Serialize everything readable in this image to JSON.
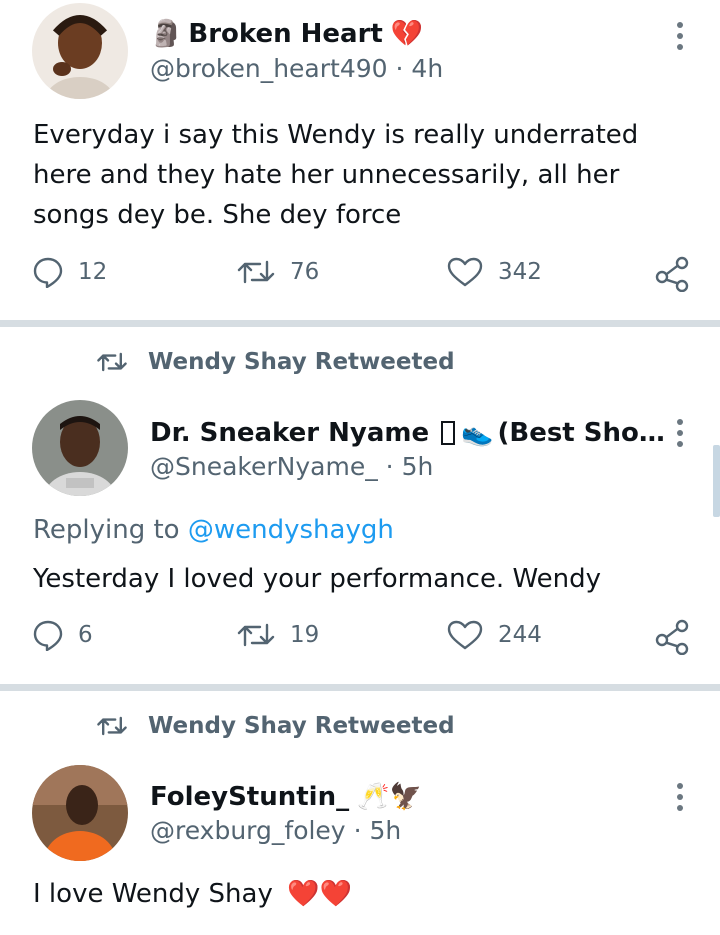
{
  "tweets": [
    {
      "display_name": "Broken Heart",
      "name_prefix_emoji": "🗿",
      "name_suffix_emoji": "💔",
      "handle": "@broken_heart490",
      "time": "4h",
      "text": "Everyday i say this Wendy is really underrated here and they hate her unnecessarily, all her songs dey be. She dey force",
      "replies": "12",
      "retweets": "76",
      "likes": "342"
    },
    {
      "retweeted_by": "Wendy Shay Retweeted",
      "display_name": "Dr. Sneaker Nyame",
      "name_emojis": "👟",
      "name_rest": "(Best Sho…",
      "handle": "@SneakerNyame_",
      "time": "5h",
      "replying_label": "Replying to",
      "replying_to": "@wendyshaygh",
      "text": "Yesterday I loved your performance. Wendy",
      "replies": "6",
      "retweets": "19",
      "likes": "244"
    },
    {
      "retweeted_by": "Wendy Shay Retweeted",
      "display_name": "FoleyStuntin_",
      "name_emojis": "🥂🦅",
      "handle": "@rexburg_foley",
      "time": "5h",
      "text": "I love Wendy Shay",
      "text_emojis": "❤️❤️"
    }
  ],
  "separator": "·",
  "colors": {
    "text": "#0f1419",
    "secondary": "#536471",
    "link": "#1d9bf0",
    "divider": "#d6dde2",
    "heart": "#e0245e"
  },
  "icons": [
    "reply-icon",
    "retweet-icon",
    "like-icon",
    "share-icon",
    "more-icon"
  ]
}
